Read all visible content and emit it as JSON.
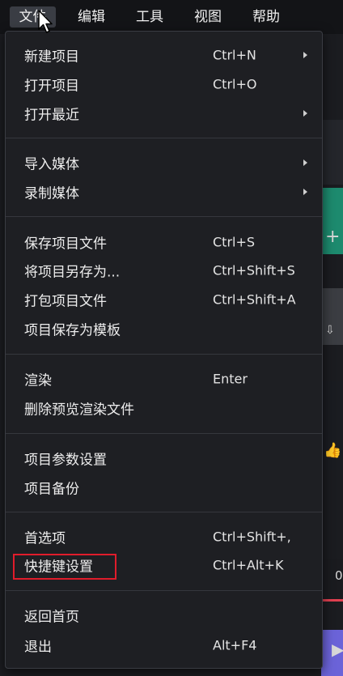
{
  "menubar": {
    "items": [
      {
        "label": "文件",
        "active": true
      },
      {
        "label": "编辑"
      },
      {
        "label": "工具"
      },
      {
        "label": "视图"
      },
      {
        "label": "帮助"
      }
    ]
  },
  "file_menu": {
    "items": [
      {
        "label": "新建项目",
        "shortcut": "Ctrl+N",
        "submenu": true
      },
      {
        "label": "打开项目",
        "shortcut": "Ctrl+O"
      },
      {
        "label": "打开最近",
        "shortcut": "",
        "submenu": true
      },
      {
        "label": "导入媒体",
        "shortcut": "",
        "submenu": true
      },
      {
        "label": "录制媒体",
        "shortcut": "",
        "submenu": true
      },
      {
        "label": "保存项目文件",
        "shortcut": "Ctrl+S"
      },
      {
        "label": "将项目另存为...",
        "shortcut": "Ctrl+Shift+S"
      },
      {
        "label": "打包项目文件",
        "shortcut": "Ctrl+Shift+A"
      },
      {
        "label": "项目保存为模板",
        "shortcut": ""
      },
      {
        "label": "渲染",
        "shortcut": "Enter"
      },
      {
        "label": "删除预览渲染文件",
        "shortcut": ""
      },
      {
        "label": "项目参数设置",
        "shortcut": ""
      },
      {
        "label": "项目备份",
        "shortcut": ""
      },
      {
        "label": "首选项",
        "shortcut": "Ctrl+Shift+,"
      },
      {
        "label": "快捷键设置",
        "shortcut": "Ctrl+Alt+K",
        "highlighted": true
      },
      {
        "label": "返回首页",
        "shortcut": ""
      },
      {
        "label": "退出",
        "shortcut": "Alt+F4"
      }
    ]
  },
  "background": {
    "edge_text": "0"
  },
  "colors": {
    "menu_bg": "#1e1f23",
    "highlight_border": "#e01c2b",
    "active_menubar": "#3a3d44"
  }
}
